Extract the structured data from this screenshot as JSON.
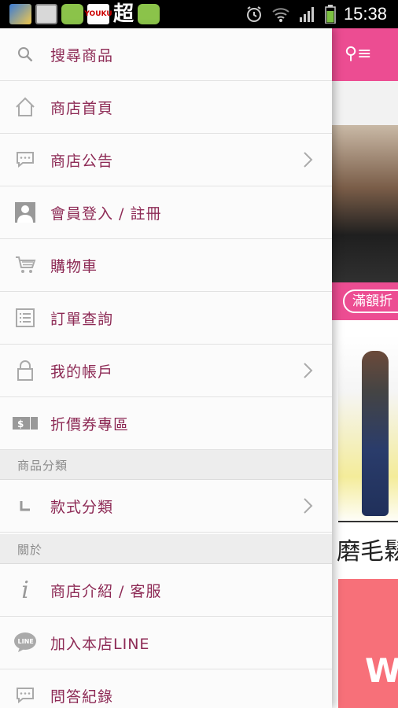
{
  "status_bar": {
    "notif_text": "超",
    "youku_label": "YOUKU",
    "time": "15:38"
  },
  "menu": {
    "items": [
      {
        "label": "搜尋商品",
        "icon": "search-icon"
      },
      {
        "label": "商店首頁",
        "icon": "home-icon"
      },
      {
        "label": "商店公告",
        "icon": "speech-bubble-icon",
        "has_chevron": true
      },
      {
        "label": "會員登入 / 註冊",
        "icon": "user-icon"
      },
      {
        "label": "購物車",
        "icon": "cart-icon"
      },
      {
        "label": "訂單查詢",
        "icon": "list-icon"
      },
      {
        "label": "我的帳戶",
        "icon": "lock-icon",
        "has_chevron": true
      },
      {
        "label": "折價券專區",
        "icon": "coupon-icon"
      }
    ],
    "section_categories": "商品分類",
    "category_item": {
      "label": "款式分類",
      "icon": "l-shape-icon",
      "has_chevron": true
    },
    "section_about": "關於",
    "about_items": [
      {
        "label": "商店介紹 / 客服",
        "icon": "info-icon"
      },
      {
        "label": "加入本店LINE",
        "icon": "line-icon",
        "icon_text": "LINE"
      },
      {
        "label": "問答紀錄",
        "icon": "chat-icon"
      }
    ]
  },
  "background_app": {
    "promo_pill": "滿額折",
    "product_caption": "磨毛鬆",
    "banner_letter": "W"
  },
  "colors": {
    "accent_pink": "#ec4d92",
    "menu_text": "#8d2a55",
    "section_bg": "#ededed"
  }
}
